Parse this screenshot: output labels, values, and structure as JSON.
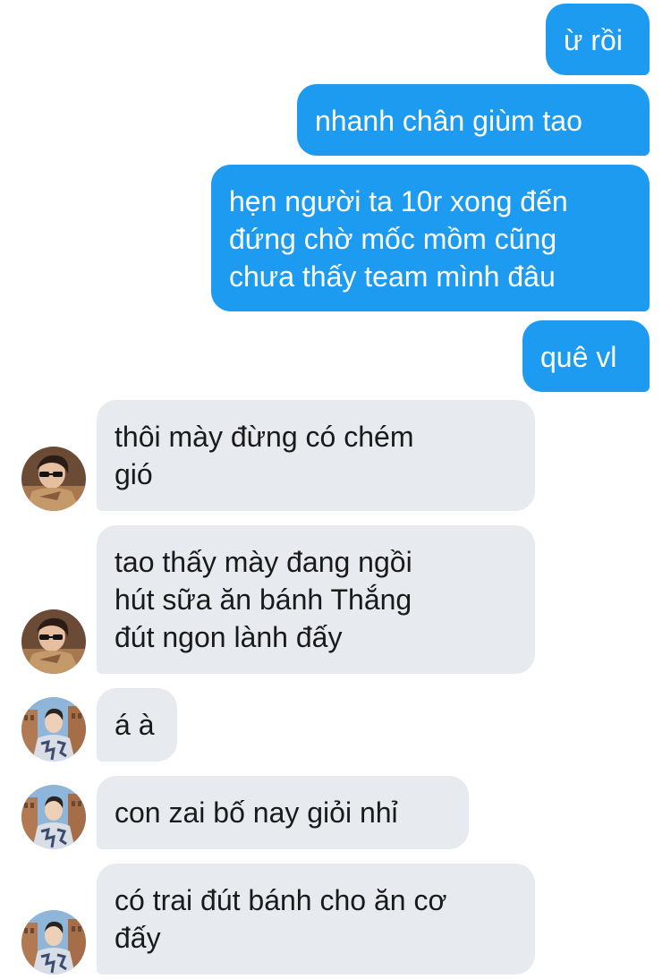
{
  "conversation": {
    "messages": [
      {
        "side": "out",
        "text": "ừ rồi"
      },
      {
        "side": "out",
        "text": "nhanh chân giùm tao"
      },
      {
        "side": "out",
        "text": "hẹn người ta 10r xong đến\nđứng chờ mốc mồm cũng\nchưa thấy team mình đâu"
      },
      {
        "side": "out",
        "text": "quê vl"
      },
      {
        "side": "in",
        "sender": "sunglasses-avatar",
        "text": "thôi mày đừng có chém\ngió"
      },
      {
        "side": "in",
        "sender": "sunglasses-avatar",
        "text": "tao thấy mày đang ngồi\nhút sữa ăn bánh Thắng\nđút ngon lành đấy"
      },
      {
        "side": "in",
        "sender": "city-avatar",
        "text": "á à"
      },
      {
        "side": "in",
        "sender": "city-avatar",
        "text": "con zai bố nay giỏi nhỉ"
      },
      {
        "side": "in",
        "sender": "city-avatar",
        "text": "có trai đút bánh cho ăn cơ\nđấy"
      }
    ]
  },
  "colors": {
    "outgoing_bubble": "#1d9bf0",
    "incoming_bubble": "#e7eaee",
    "incoming_text": "#1a1a1a"
  }
}
